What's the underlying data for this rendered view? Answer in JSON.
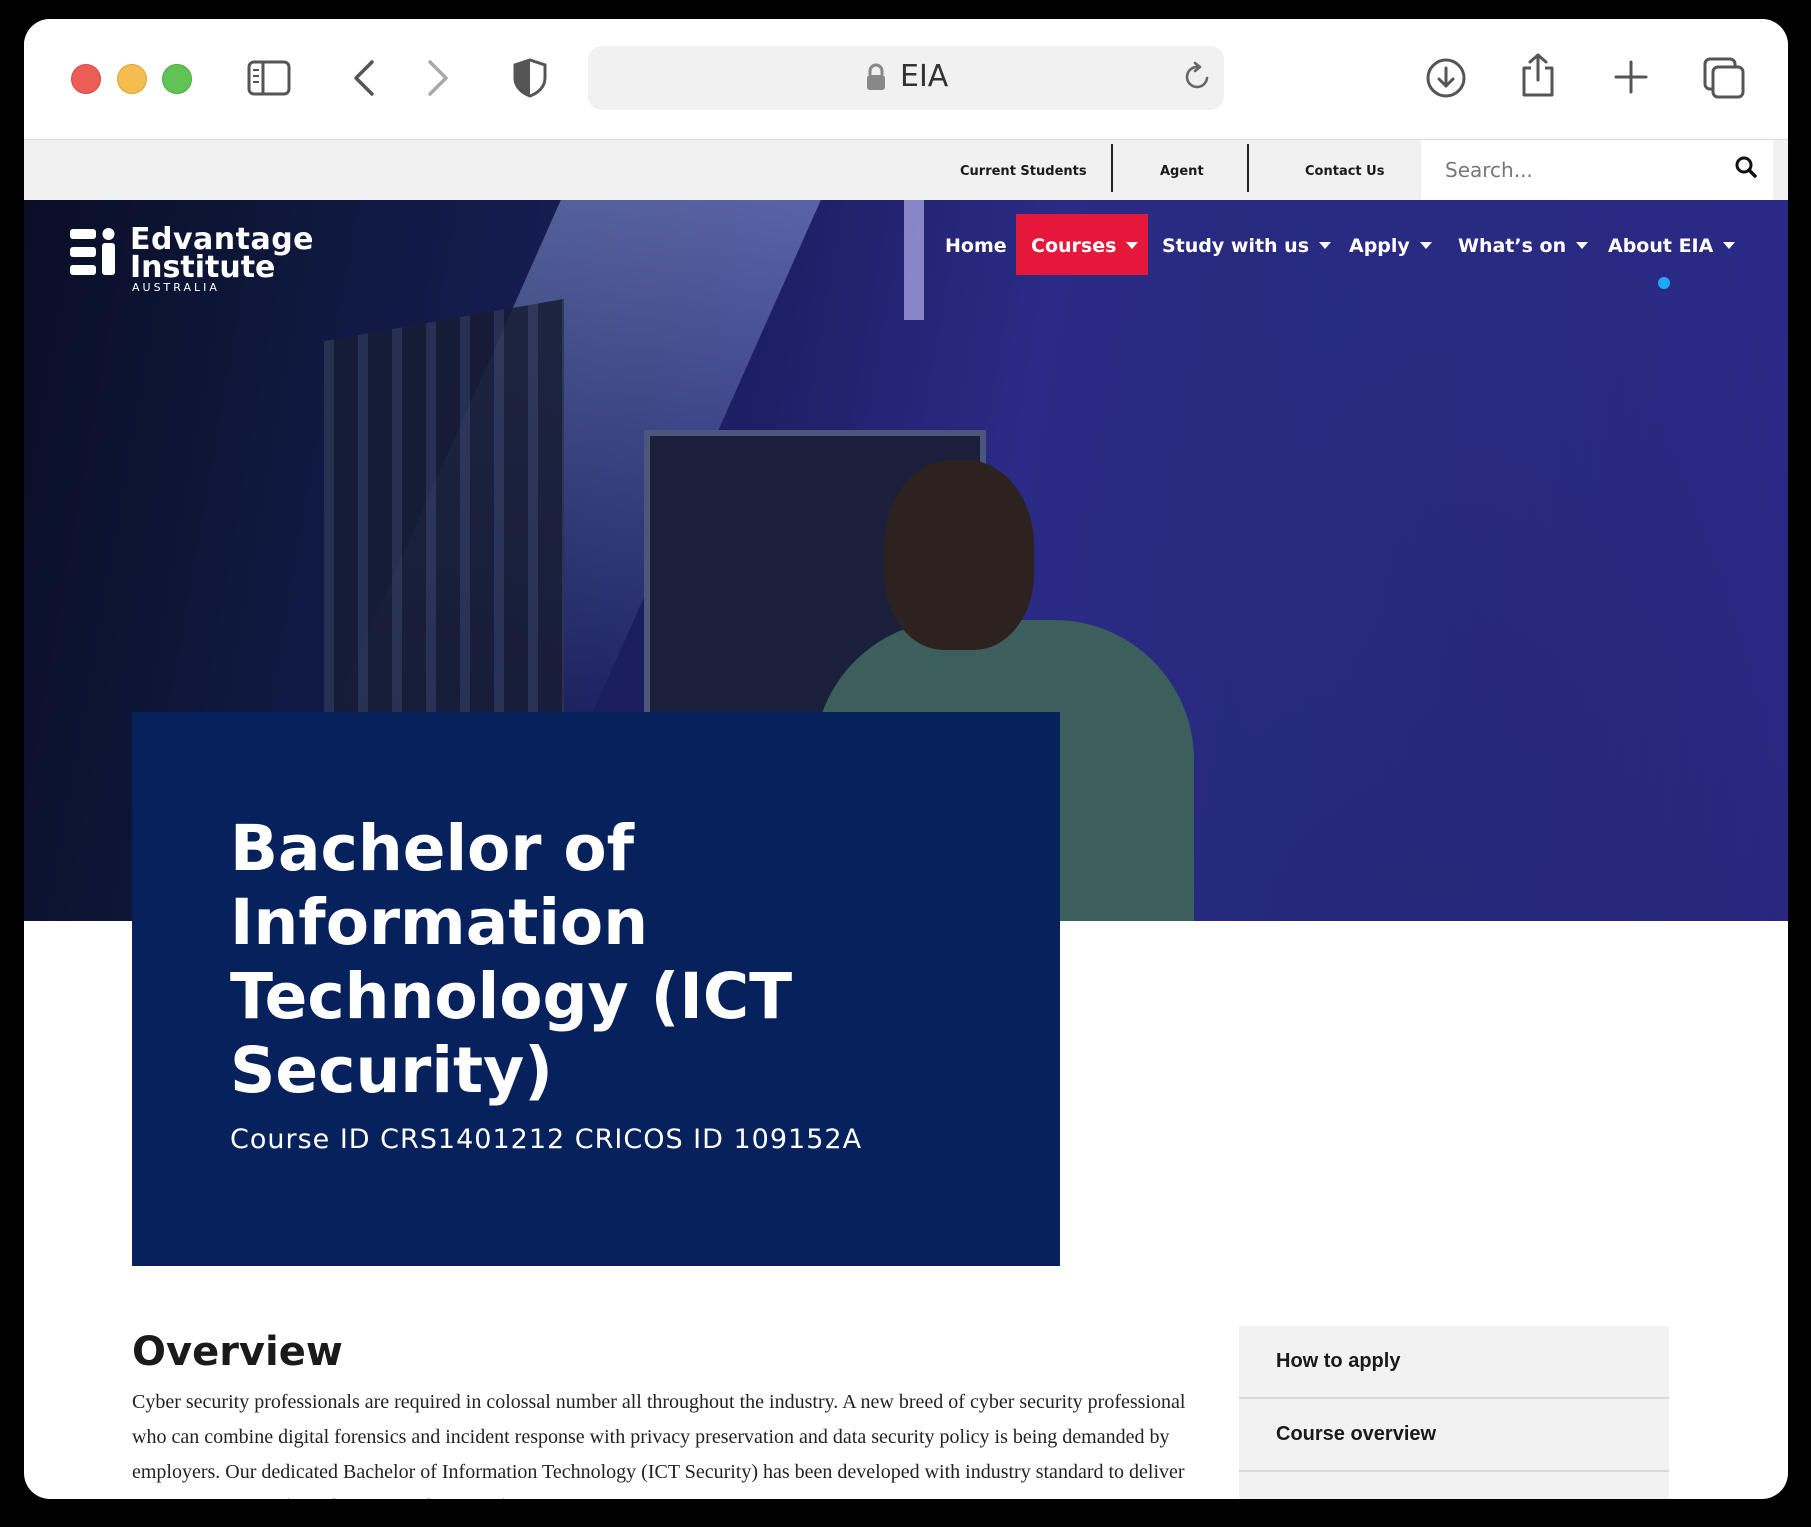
{
  "browser": {
    "url_text": "EIA"
  },
  "utility_nav": {
    "links": [
      "Current Students",
      "Agent",
      "Contact Us"
    ],
    "search_placeholder": "Search..."
  },
  "logo": {
    "line1": "Edvantage",
    "line2": "Institute",
    "line3": "AUSTRALIA"
  },
  "main_nav": {
    "items": [
      {
        "label": "Home",
        "dropdown": false
      },
      {
        "label": "Courses",
        "dropdown": true,
        "active": true
      },
      {
        "label": "Study with us",
        "dropdown": true
      },
      {
        "label": "Apply",
        "dropdown": true
      },
      {
        "label": "What’s on",
        "dropdown": true
      },
      {
        "label": "About EIA",
        "dropdown": true
      }
    ]
  },
  "course": {
    "title": "Bachelor of Information Technology (ICT Security)",
    "id_line": "Course ID CRS1401212 CRICOS ID 109152A"
  },
  "overview": {
    "heading": "Overview",
    "body": "Cyber security professionals are required in colossal number all throughout the industry. A new breed of cyber security professional who can combine digital forensics and incident response with privacy preservation and data security policy is being demanded by employers. Our dedicated Bachelor of Information Technology (ICT Security) has been developed with industry standard to deliver these expectations for industry including satisfying their ever growing requirements."
  },
  "sidebar": {
    "items": [
      "How to apply",
      "Course overview"
    ]
  },
  "colors": {
    "accent_red": "#e5173b",
    "navy": "#06215c",
    "dot_blue": "#1ea7f5"
  }
}
